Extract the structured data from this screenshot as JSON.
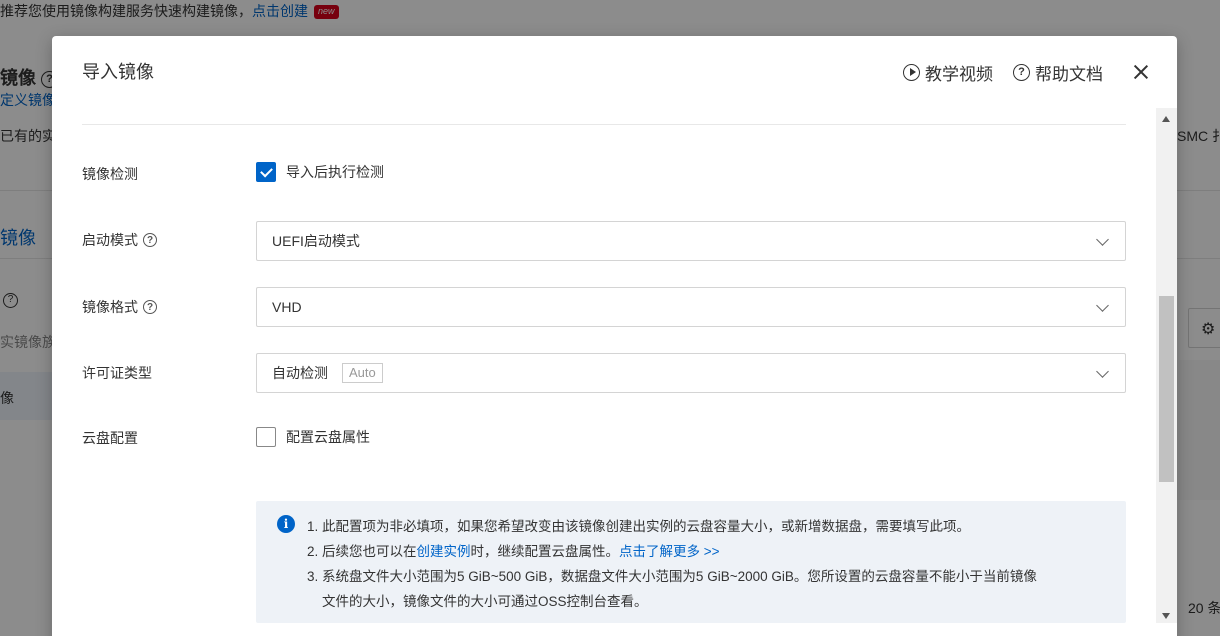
{
  "background": {
    "banner_text": "推荐您使用镜像构建服务快速构建镜像，",
    "banner_link": "点击创建",
    "banner_badge": "new",
    "title_fragment": "镜像",
    "subtitle_fragment": "定义镜像",
    "desc_fragment": "已有的实",
    "tab_fragment": "镜像",
    "filter_fragment": "实镜像族",
    "row_fragment": "像",
    "right_desc_fragment": "SMC 扌",
    "pagesize_fragment": "20 条"
  },
  "modal": {
    "title": "导入镜像",
    "video_link": "教学视频",
    "docs_link": "帮助文档"
  },
  "form": {
    "check_label": "镜像检测",
    "check_option": "导入后执行检测",
    "check_checked": true,
    "boot_label": "启动模式",
    "boot_value": "UEFI启动模式",
    "format_label": "镜像格式",
    "format_value": "VHD",
    "license_label": "许可证类型",
    "license_value": "自动检测",
    "license_tag": "Auto",
    "disk_label": "云盘配置",
    "disk_option": "配置云盘属性",
    "disk_checked": false
  },
  "info": {
    "line1": "1. 此配置项为非必填项，如果您希望改变由该镜像创建出实例的云盘容量大小，或新增数据盘，需要填写此项。",
    "line2_pre": "2. 后续您也可以在",
    "line2_link": "创建实例",
    "line2_mid": "时，继续配置云盘属性。",
    "line2_link2": "点击了解更多 >>",
    "line3a": "3. 系统盘文件大小范围为5 GiB~500 GiB，数据盘文件大小范围为5 GiB~2000 GiB。您所设置的云盘容量不能小于当前镜像",
    "line3b": "文件的大小，镜像文件的大小可通过OSS控制台查看。"
  }
}
